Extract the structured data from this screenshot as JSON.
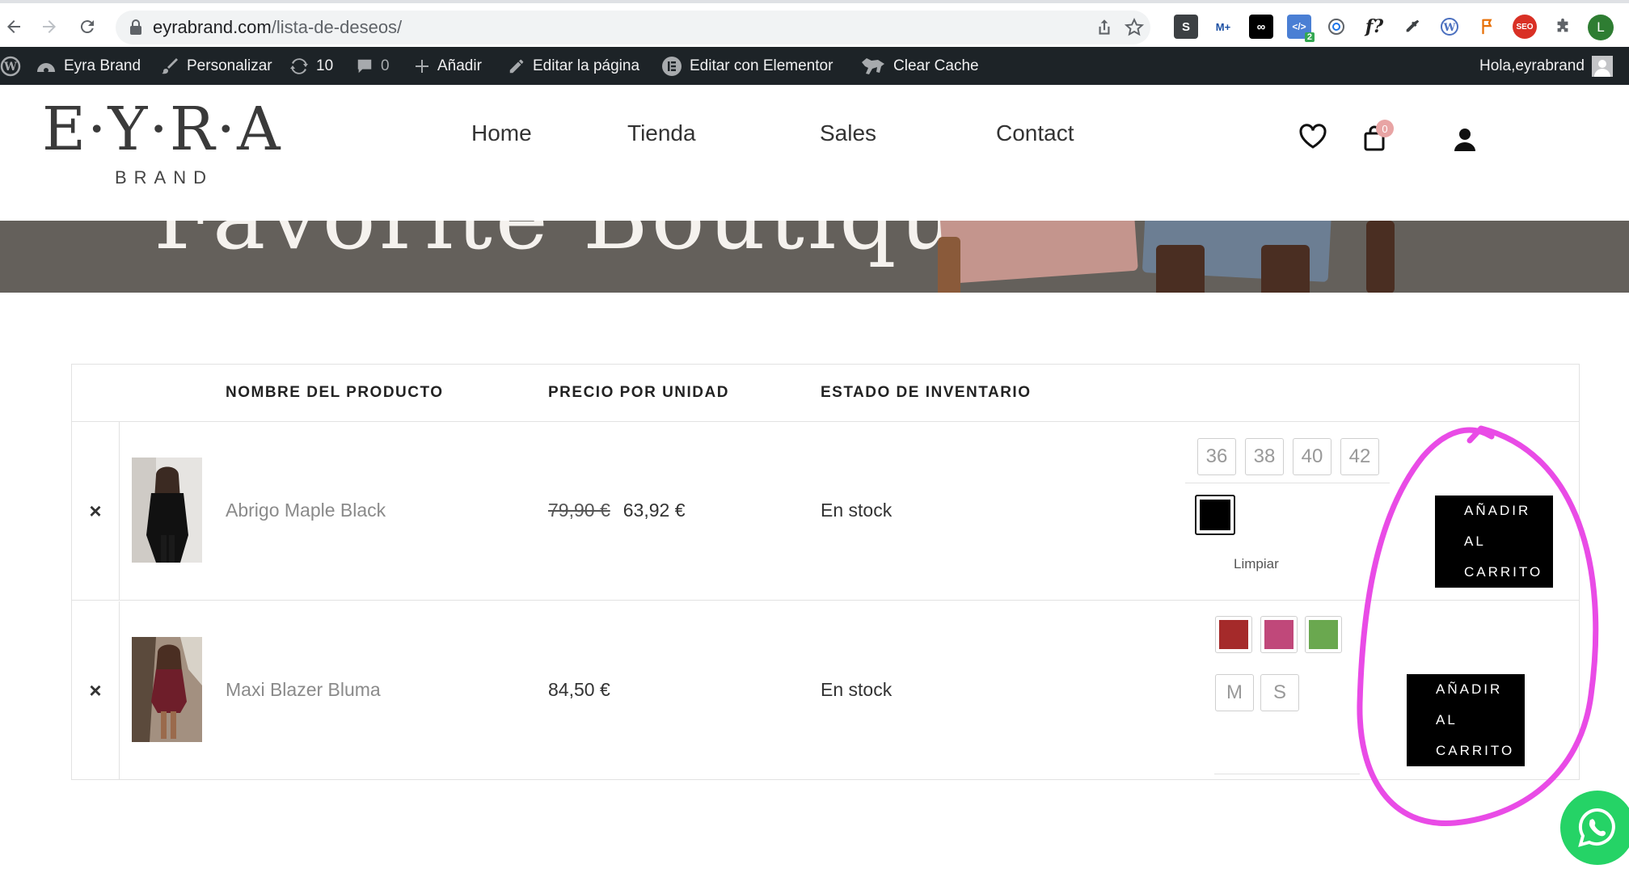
{
  "browser": {
    "url_domain": "eyrabrand.com",
    "url_path": "/lista-de-deseos/",
    "extensions": [
      "S",
      "M+",
      "∞",
      "2",
      "f?",
      "L"
    ]
  },
  "admin_bar": {
    "site_name": "Eyra Brand",
    "customize": "Personalizar",
    "updates": "10",
    "comments": "0",
    "add_new": "Añadir",
    "edit_page": "Editar la página",
    "edit_elementor": "Editar con Elementor",
    "clear_cache": "Clear Cache",
    "greeting": "Hola,",
    "username": "eyrabrand"
  },
  "header": {
    "logo_main": "E·Y·R·A",
    "logo_sub": "BRAND",
    "menu": [
      "Home",
      "Tienda",
      "Sales",
      "Contact"
    ],
    "cart_count": "0"
  },
  "hero": {
    "title_fragment": "Favorite Boutique"
  },
  "wishlist": {
    "columns": {
      "product_name": "NOMBRE DEL PRODUCTO",
      "unit_price": "PRECIO POR UNIDAD",
      "stock_status": "ESTADO DE INVENTARIO"
    },
    "rows": [
      {
        "remove": "×",
        "name": "Abrigo Maple Black",
        "price_old": "79,90 €",
        "price": "63,92 €",
        "stock": "En stock",
        "sizes": [
          "36",
          "38",
          "40",
          "42"
        ],
        "colors": [
          "#000000"
        ],
        "clear_label": "Limpiar",
        "add_label": "AÑADIR\nAL\nCARRITO"
      },
      {
        "remove": "×",
        "name": "Maxi Blazer Bluma",
        "price_old": "",
        "price": "84,50 €",
        "stock": "En stock",
        "sizes": [
          "M",
          "S"
        ],
        "colors": [
          "#a52a2a",
          "#c0487a",
          "#6aa84f"
        ],
        "clear_label": "",
        "add_label": "AÑADIR\nAL\nCARRITO"
      }
    ]
  },
  "colors": {
    "admin_bar_bg": "#1d2327",
    "annotation": "#e94be6",
    "whatsapp": "#25d366"
  }
}
